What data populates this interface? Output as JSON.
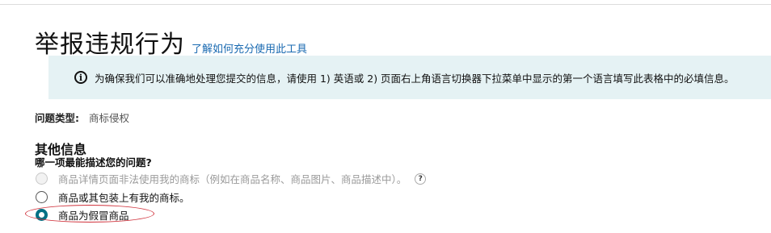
{
  "header": {
    "title": "举报违规行为",
    "help_link": "了解如何充分使用此工具"
  },
  "banner": {
    "icon": "info-icon",
    "text": "为确保我们可以准确地处理您提交的信息，请使用 1) 英语或 2) 页面右上角语言切换器下拉菜单中显示的第一个语言填写此表格中的必填信息。"
  },
  "issue": {
    "label": "问题类型:",
    "value": "商标侵权"
  },
  "section": {
    "title": "其他信息",
    "question": "哪一项最能描述您的问题?",
    "options": [
      {
        "label": "商品详情页面非法使用我的商标（例如在商品名称、商品图片、商品描述中）。",
        "state": "disabled",
        "help": "?"
      },
      {
        "label": "商品或其包装上有我的商标。",
        "state": "unselected"
      },
      {
        "label": "商品为假冒商品",
        "state": "selected"
      }
    ]
  },
  "colors": {
    "link": "#1a6ab1",
    "banner_bg": "#e5f2f4",
    "radio_selected": "#007185",
    "annotation": "#d0313b"
  }
}
